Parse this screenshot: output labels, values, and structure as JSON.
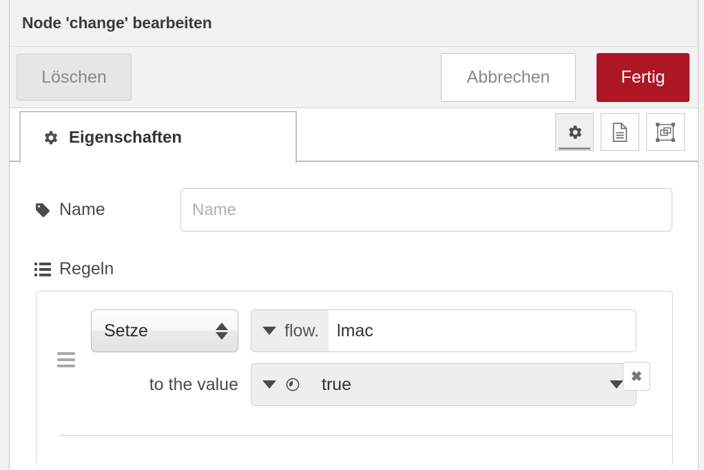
{
  "dialog": {
    "title": "Node 'change' bearbeiten"
  },
  "actions": {
    "delete_label": "Löschen",
    "cancel_label": "Abbrechen",
    "done_label": "Fertig",
    "done_color": "#ad1625"
  },
  "tabs": [
    {
      "label": "Eigenschaften",
      "icon": "gear-icon",
      "active": true
    }
  ],
  "tab_tools": [
    {
      "name": "properties-gear-icon",
      "active": true
    },
    {
      "name": "description-document-icon",
      "active": false
    },
    {
      "name": "appearance-node-icon",
      "active": false
    }
  ],
  "form": {
    "name": {
      "label": "Name",
      "icon": "tag-icon",
      "value": "",
      "placeholder": "Name"
    },
    "rules_label": "Regeln",
    "rules_icon": "list-icon"
  },
  "rules": [
    {
      "action": "Setze",
      "property_type": "flow.",
      "property_value": "lmac",
      "to_value_label": "to the value",
      "value_type_icon": "boolean-icon",
      "value": "true",
      "delete_label": "✖"
    }
  ]
}
